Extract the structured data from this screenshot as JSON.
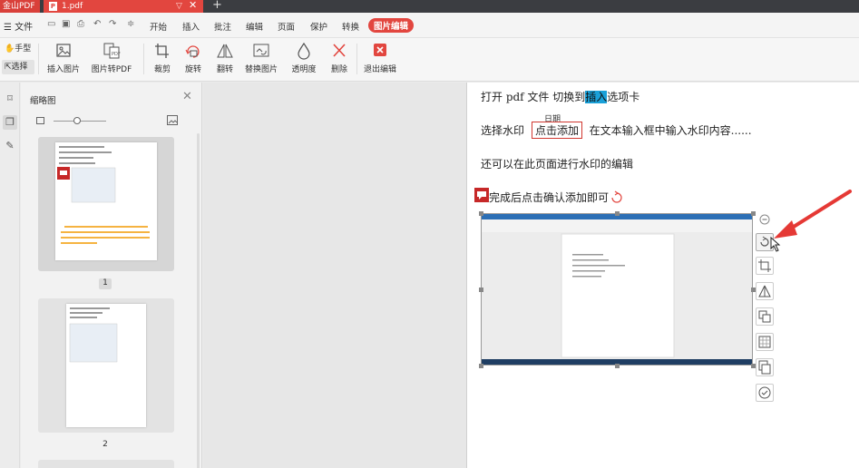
{
  "titlebar": {
    "app_name": "金山PDF",
    "doc_tab": "1.pdf",
    "pin": "▽",
    "close": "✕",
    "new_tab": "+"
  },
  "menu": {
    "file": "☰ 文件",
    "tabs": [
      "开始",
      "插入",
      "批注",
      "编辑",
      "页面",
      "保护",
      "转换",
      "图片编辑"
    ],
    "active_tab": "图片编辑"
  },
  "ribbon": {
    "hand": "手型",
    "select": "选择",
    "buttons": [
      "插入图片",
      "图片转PDF",
      "裁剪",
      "旋转",
      "翻转",
      "替换图片",
      "透明度",
      "删除",
      "退出编辑"
    ]
  },
  "thumbnails": {
    "title": "缩略图",
    "pages": [
      "1",
      "2"
    ]
  },
  "document": {
    "line1_a": "打开 pdf 文件   切换到",
    "line1_hl": "插入",
    "line1_b": "选项卡",
    "line2_a": "选择水印",
    "line2_box": "点击添加",
    "line2_b": "在文本输入框中输入水印内容......",
    "line2_small": "日期",
    "line3": "还可以在此页面进行水印的编辑",
    "line4": "完成后点击确认添加即可"
  },
  "colors": {
    "accent": "#e2463f",
    "highlight": "#1aa0d8",
    "arrow": "#e53935"
  }
}
